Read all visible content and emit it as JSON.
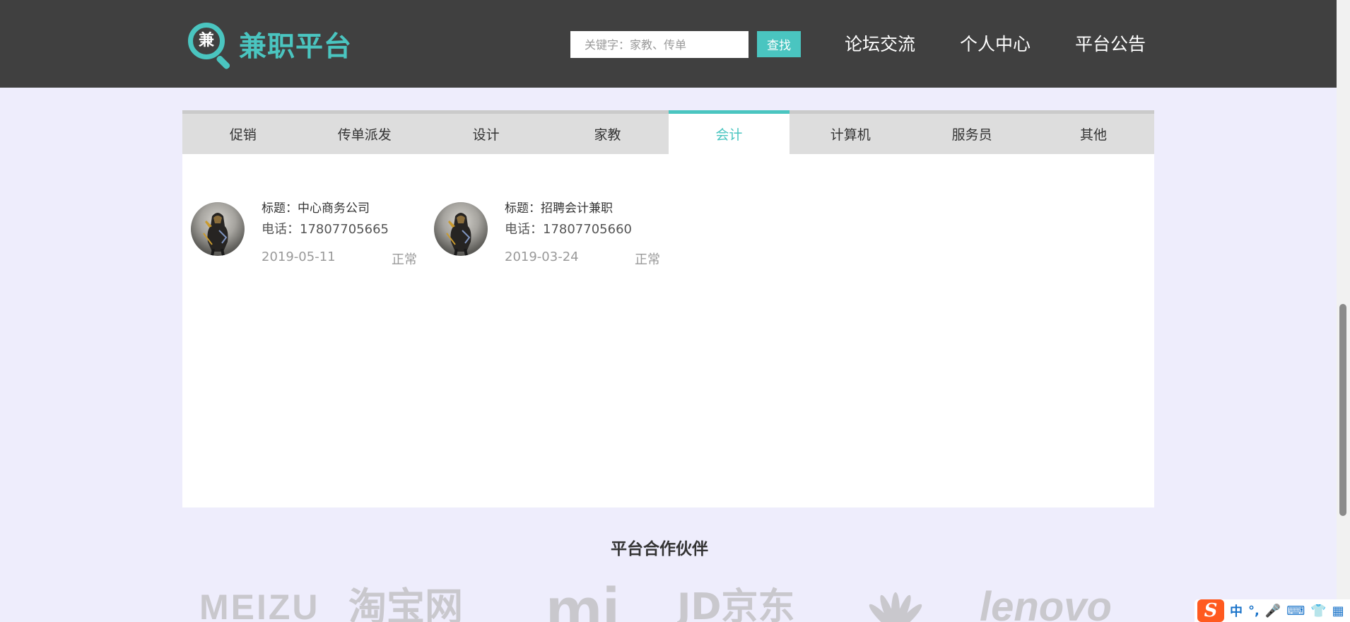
{
  "brand": {
    "name": "兼职平台",
    "mark_char": "兼"
  },
  "search": {
    "placeholder": "关键字：家教、传单",
    "button_label": "查找"
  },
  "nav": [
    "论坛交流",
    "个人中心",
    "平台公告"
  ],
  "tabs": [
    "促销",
    "传单派发",
    "设计",
    "家教",
    "会计",
    "计算机",
    "服务员",
    "其他"
  ],
  "active_tab": "会计",
  "listings": [
    {
      "title": "标题：中心商务公司",
      "phone": "电话：17807705665",
      "date": "2019-05-11",
      "status": "正常"
    },
    {
      "title": "标题：招聘会计兼职",
      "phone": "电话：17807705660",
      "date": "2019-03-24",
      "status": "正常"
    }
  ],
  "partners": {
    "title": "平台合作伙伴",
    "logos": [
      "MEIZU",
      "淘宝网",
      "mi",
      "JD京东",
      "huawei-logo",
      "lenovo"
    ]
  },
  "ime": {
    "brand": "S",
    "items": [
      "中",
      "°,",
      "mic-icon",
      "keyboard-icon",
      "shirt-icon",
      "grid-icon"
    ]
  },
  "colors": {
    "header": "#404040",
    "accent": "#4ac5c0",
    "page_bg": "#eeedfc",
    "tab_bg": "#dddddd"
  }
}
